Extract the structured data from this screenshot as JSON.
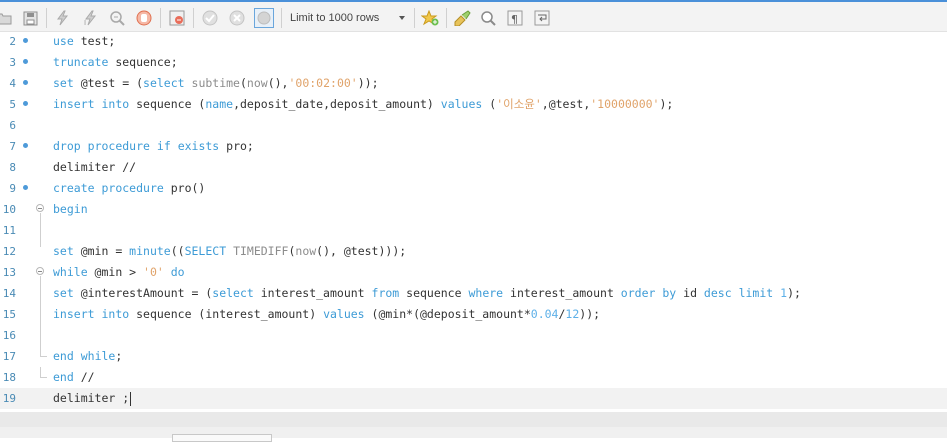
{
  "toolbar": {
    "limit_label": "Limit to 1000 rows",
    "icons": [
      "open-folder-icon",
      "save-icon",
      "execute-icon",
      "execute-current-icon",
      "explain-icon",
      "stop-icon",
      "toggle-error-icon",
      "commit-icon",
      "rollback-icon",
      "autocommit-icon",
      "bookmark-icon",
      "beautify-icon",
      "find-icon",
      "invisible-chars-icon",
      "wrap-icon"
    ]
  },
  "editor": {
    "lines": [
      {
        "n": "2",
        "segs": [
          {
            "t": "use",
            "c": "kw"
          },
          {
            "t": " test;"
          }
        ]
      },
      {
        "n": "3",
        "segs": [
          {
            "t": "truncate",
            "c": "kw"
          },
          {
            "t": " sequence;"
          }
        ]
      },
      {
        "n": "4",
        "segs": [
          {
            "t": "set",
            "c": "kw"
          },
          {
            "t": " @test = ("
          },
          {
            "t": "select",
            "c": "kw"
          },
          {
            "t": " "
          },
          {
            "t": "subtime",
            "c": "fn"
          },
          {
            "t": "("
          },
          {
            "t": "now",
            "c": "fn"
          },
          {
            "t": "(),"
          },
          {
            "t": "'00:02:00'",
            "c": "str"
          },
          {
            "t": "));"
          }
        ]
      },
      {
        "n": "5",
        "segs": [
          {
            "t": "insert",
            "c": "kw"
          },
          {
            "t": " "
          },
          {
            "t": "into",
            "c": "kw"
          },
          {
            "t": " sequence ("
          },
          {
            "t": "name",
            "c": "kw"
          },
          {
            "t": ",deposit_date,deposit_amount) "
          },
          {
            "t": "values",
            "c": "kw"
          },
          {
            "t": " ("
          },
          {
            "t": "'이소윤'",
            "c": "str"
          },
          {
            "t": ",@test,"
          },
          {
            "t": "'10000000'",
            "c": "str"
          },
          {
            "t": ");"
          }
        ]
      },
      {
        "n": "6",
        "segs": []
      },
      {
        "n": "7",
        "segs": [
          {
            "t": "drop",
            "c": "kw"
          },
          {
            "t": " "
          },
          {
            "t": "procedure",
            "c": "kw"
          },
          {
            "t": " "
          },
          {
            "t": "if",
            "c": "kw"
          },
          {
            "t": " "
          },
          {
            "t": "exists",
            "c": "kw"
          },
          {
            "t": " pro;"
          }
        ]
      },
      {
        "n": "8",
        "segs": [
          {
            "t": "delimiter //"
          }
        ]
      },
      {
        "n": "9",
        "segs": [
          {
            "t": "create",
            "c": "kw"
          },
          {
            "t": " "
          },
          {
            "t": "procedure",
            "c": "kw"
          },
          {
            "t": " pro()"
          }
        ]
      },
      {
        "n": "10",
        "segs": [
          {
            "t": "begin",
            "c": "kw"
          }
        ]
      },
      {
        "n": "11",
        "segs": []
      },
      {
        "n": "12",
        "segs": [
          {
            "t": "set",
            "c": "kw"
          },
          {
            "t": " @min = "
          },
          {
            "t": "minute",
            "c": "kw"
          },
          {
            "t": "(("
          },
          {
            "t": "SELECT",
            "c": "kw"
          },
          {
            "t": " "
          },
          {
            "t": "TIMEDIFF",
            "c": "fn"
          },
          {
            "t": "("
          },
          {
            "t": "now",
            "c": "fn"
          },
          {
            "t": "(), @test)));"
          }
        ]
      },
      {
        "n": "13",
        "segs": [
          {
            "t": "while",
            "c": "kw"
          },
          {
            "t": " @min > "
          },
          {
            "t": "'0'",
            "c": "str"
          },
          {
            "t": " "
          },
          {
            "t": "do",
            "c": "kw"
          }
        ]
      },
      {
        "n": "14",
        "segs": [
          {
            "t": "set",
            "c": "kw"
          },
          {
            "t": " @interestAmount = ("
          },
          {
            "t": "select",
            "c": "kw"
          },
          {
            "t": " interest_amount "
          },
          {
            "t": "from",
            "c": "kw"
          },
          {
            "t": " sequence "
          },
          {
            "t": "where",
            "c": "kw"
          },
          {
            "t": " interest_amount "
          },
          {
            "t": "order",
            "c": "kw"
          },
          {
            "t": " "
          },
          {
            "t": "by",
            "c": "kw"
          },
          {
            "t": " id "
          },
          {
            "t": "desc",
            "c": "kw"
          },
          {
            "t": " "
          },
          {
            "t": "limit",
            "c": "kw"
          },
          {
            "t": " "
          },
          {
            "t": "1",
            "c": "num"
          },
          {
            "t": ");"
          }
        ]
      },
      {
        "n": "15",
        "segs": [
          {
            "t": "insert",
            "c": "kw"
          },
          {
            "t": " "
          },
          {
            "t": "into",
            "c": "kw"
          },
          {
            "t": " sequence (interest_amount) "
          },
          {
            "t": "values",
            "c": "kw"
          },
          {
            "t": " (@min*(@deposit_amount*"
          },
          {
            "t": "0.04",
            "c": "num"
          },
          {
            "t": "/"
          },
          {
            "t": "12",
            "c": "num"
          },
          {
            "t": "));"
          }
        ]
      },
      {
        "n": "16",
        "segs": []
      },
      {
        "n": "17",
        "segs": [
          {
            "t": "end",
            "c": "kw"
          },
          {
            "t": " "
          },
          {
            "t": "while",
            "c": "kw"
          },
          {
            "t": ";"
          }
        ]
      },
      {
        "n": "18",
        "segs": [
          {
            "t": "end",
            "c": "kw"
          },
          {
            "t": " //"
          }
        ]
      },
      {
        "n": "19",
        "segs": [
          {
            "t": "delimiter ;"
          }
        ]
      }
    ]
  }
}
